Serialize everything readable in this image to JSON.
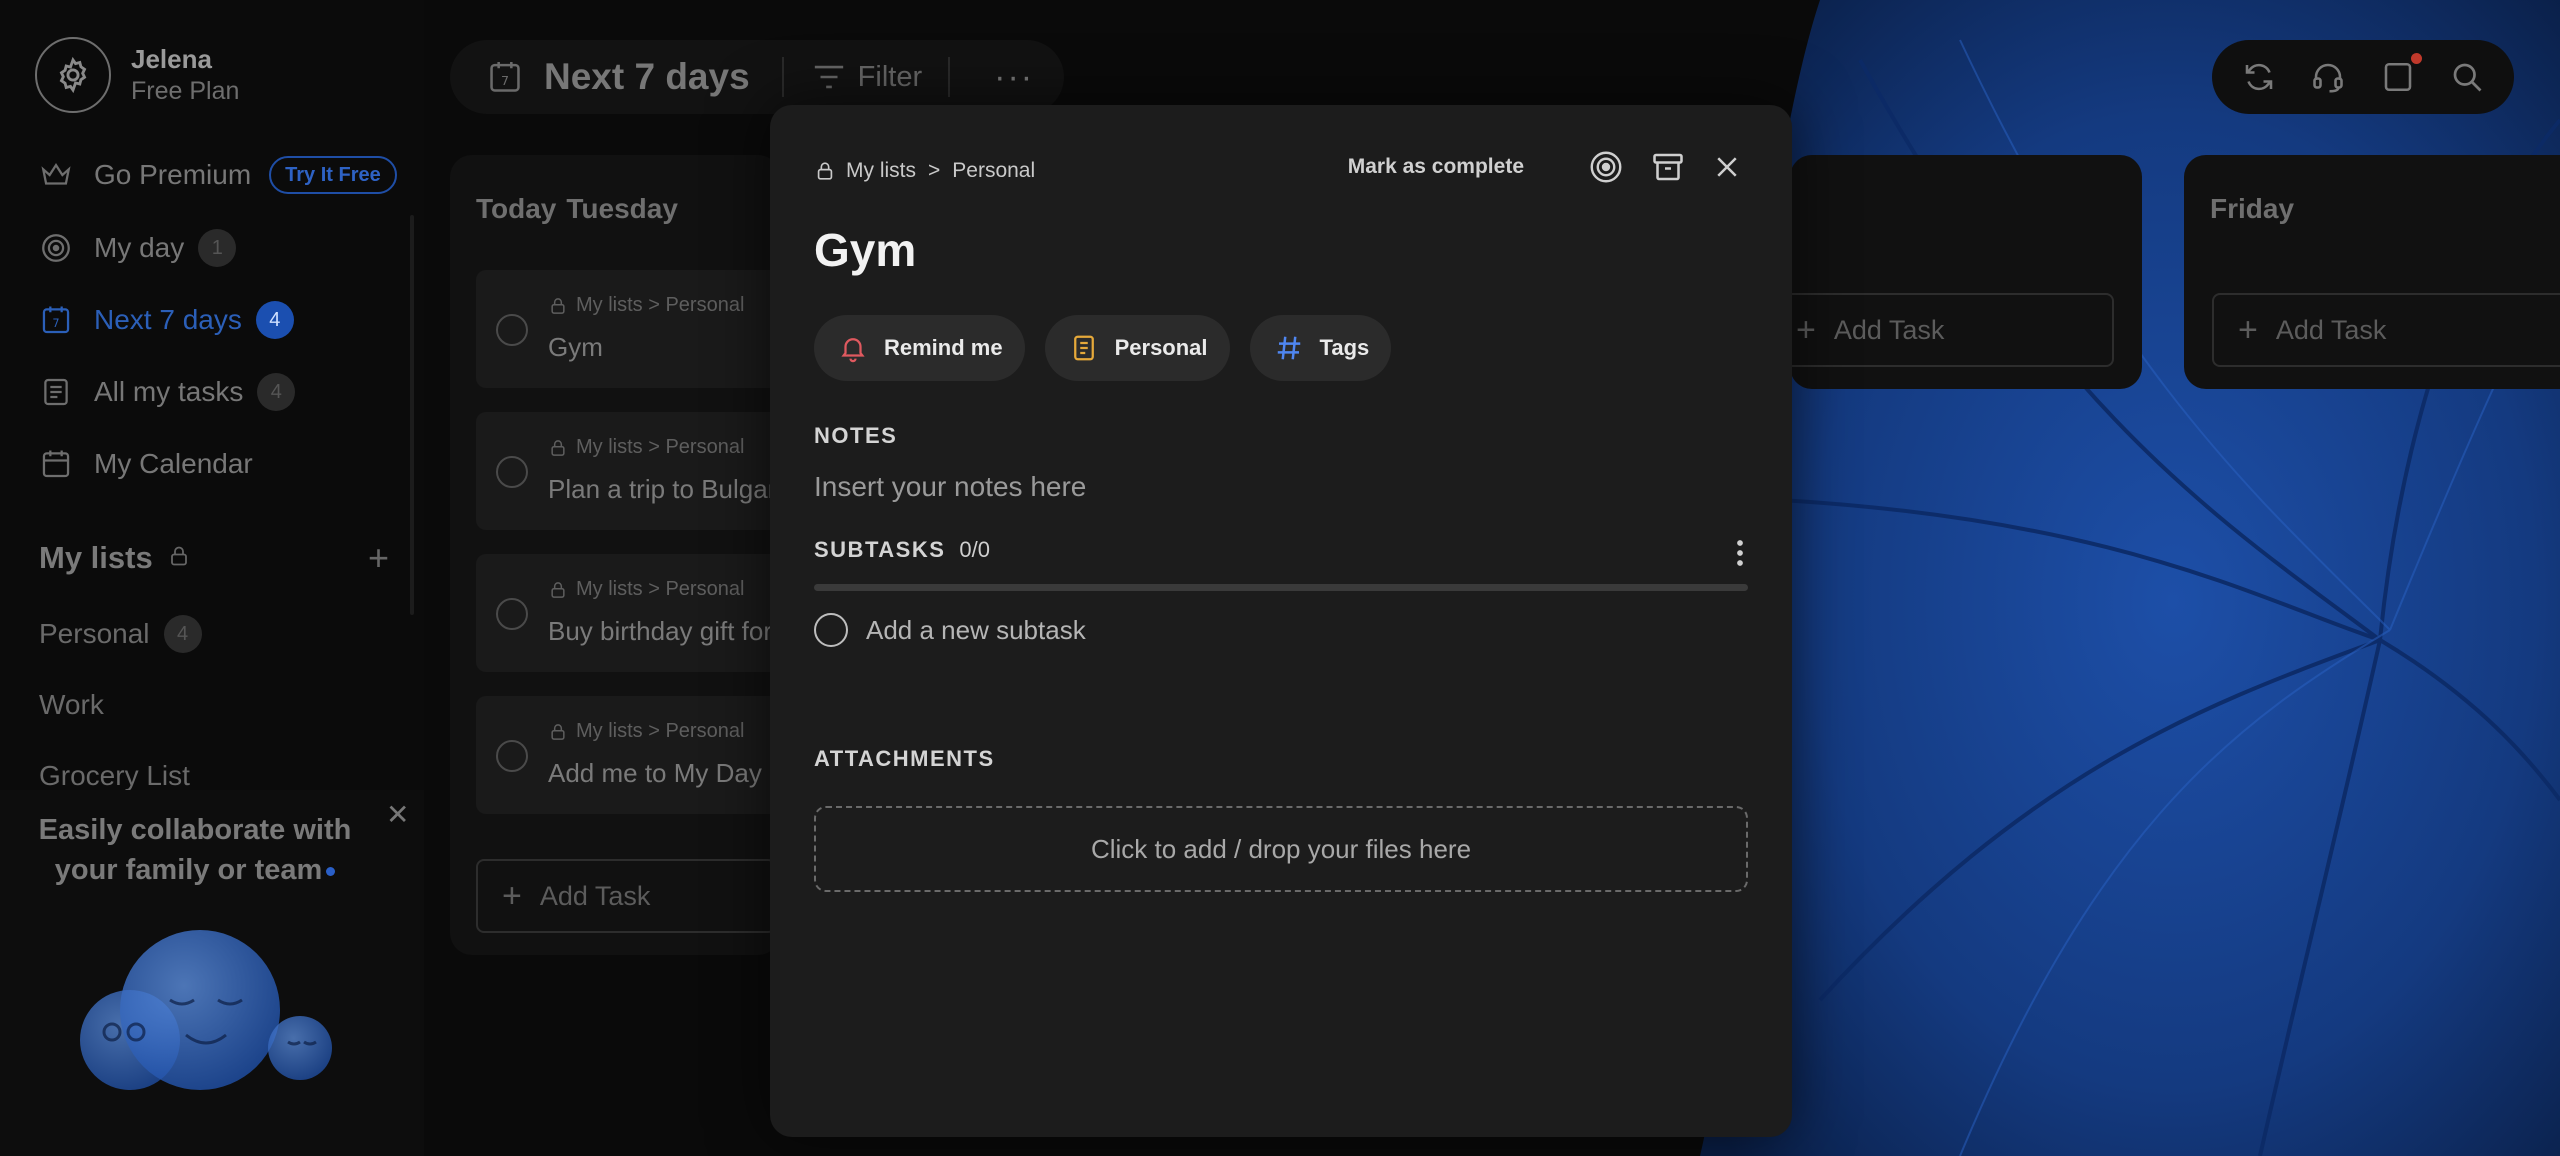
{
  "colors": {
    "accent": "#2b5fb8",
    "modal_bg": "#1c1c1c",
    "remind_icon": "#e0595f",
    "list_icon": "#e6a93a",
    "tags_icon": "#4f86f0"
  },
  "profile": {
    "name": "Jelena",
    "plan": "Free Plan"
  },
  "nav": {
    "premium": {
      "label": "Go Premium",
      "pill": "Try It Free"
    },
    "my_day": {
      "label": "My day",
      "count": "1"
    },
    "next7": {
      "label": "Next 7 days",
      "count": "4"
    },
    "all_tasks": {
      "label": "All my tasks",
      "count": "4"
    },
    "calendar": {
      "label": "My Calendar"
    }
  },
  "lists": {
    "title": "My lists",
    "items": [
      {
        "label": "Personal",
        "count": "4"
      },
      {
        "label": "Work"
      },
      {
        "label": "Grocery List"
      }
    ]
  },
  "promo": {
    "text": "Easily collaborate with your family or team"
  },
  "topbar": {
    "title": "Next 7 days",
    "calendar_day": "7",
    "filter": "Filter"
  },
  "today": {
    "label": "Today",
    "day": "Tuesday",
    "tasks": [
      {
        "crumb": "My lists > Personal",
        "name": "Gym"
      },
      {
        "crumb": "My lists > Personal",
        "name": "Plan a trip to Bulgaria"
      },
      {
        "crumb": "My lists > Personal",
        "name": "Buy birthday gift for"
      },
      {
        "crumb": "My lists > Personal",
        "name": "Add me to My Day"
      }
    ],
    "add_task": "Add Task"
  },
  "thursday": {
    "add_task": "Add Task"
  },
  "friday": {
    "label": "Friday",
    "add_task": "Add Task"
  },
  "modal": {
    "crumb_root": "My lists",
    "crumb_sep": ">",
    "crumb_list": "Personal",
    "mark_complete": "Mark as complete",
    "title": "Gym",
    "chips": {
      "remind": "Remind me",
      "list": "Personal",
      "tags": "Tags"
    },
    "notes_label": "NOTES",
    "notes_placeholder": "Insert your notes here",
    "subtasks_label": "SUBTASKS",
    "subtasks_count": "0/0",
    "subtask_progress": 0,
    "new_subtask": "Add a new subtask",
    "attachments_label": "ATTACHMENTS",
    "dropzone": "Click to add / drop your files here"
  }
}
